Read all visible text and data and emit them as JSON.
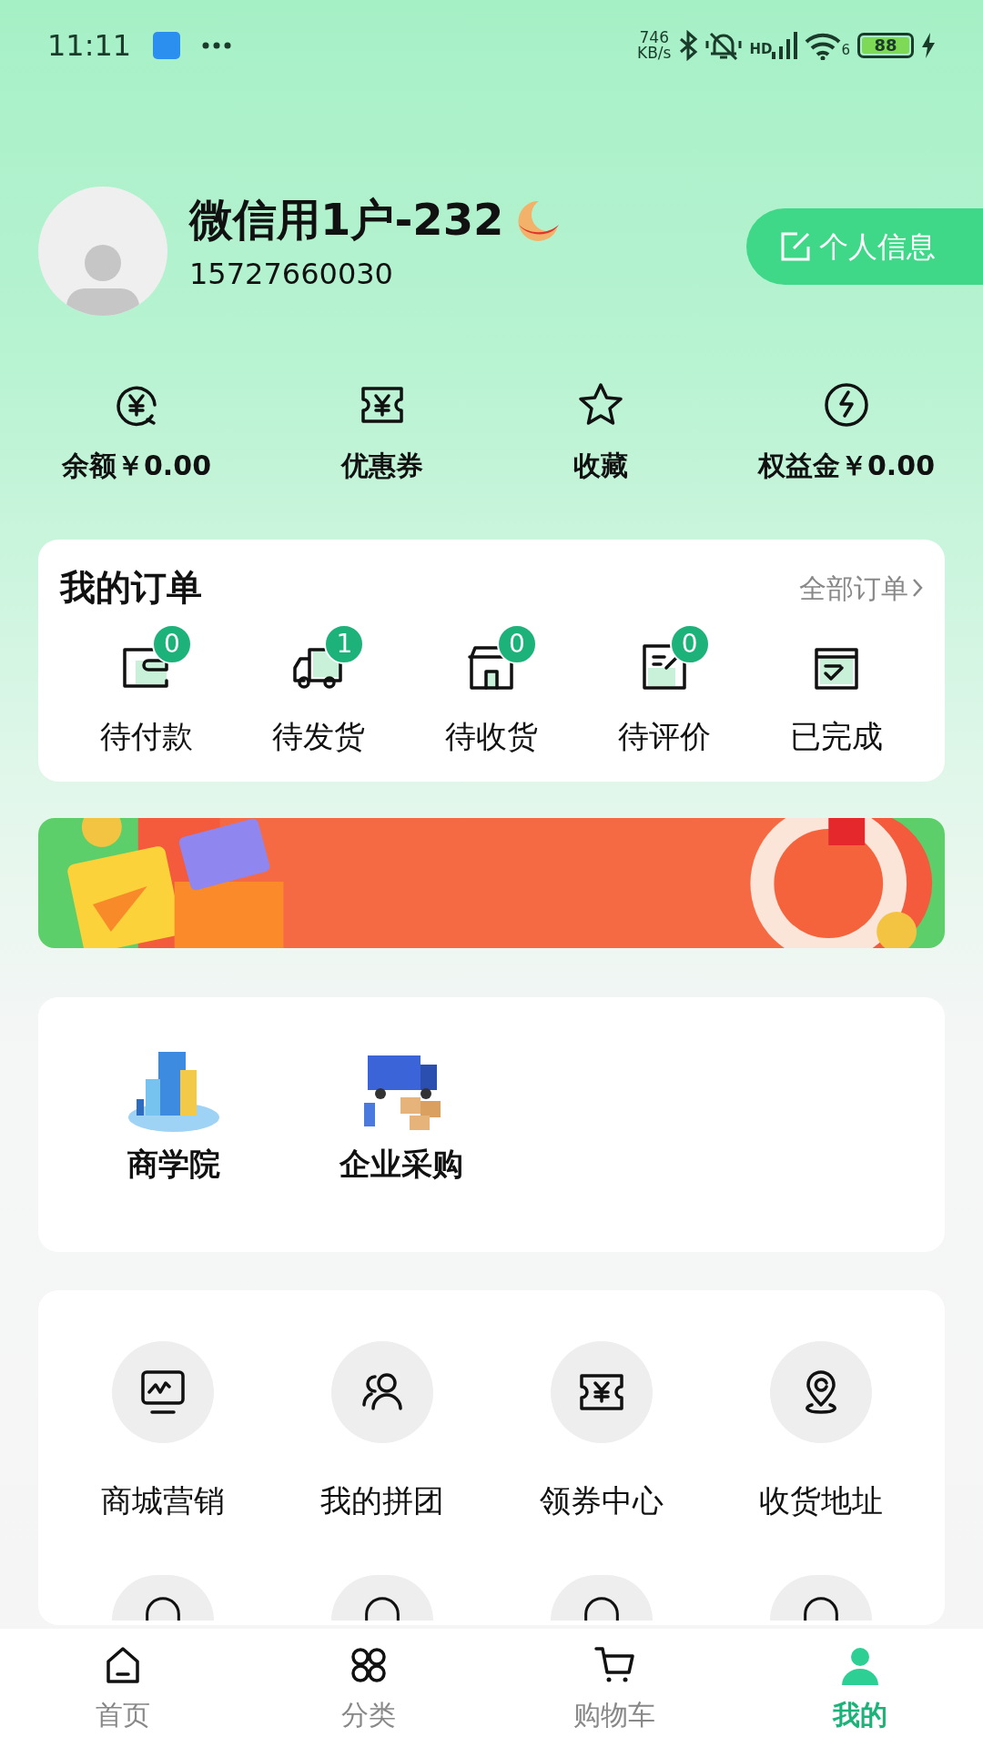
{
  "status_bar": {
    "time": "11:11",
    "net_speed": "746",
    "net_unit": "KB/s",
    "signal_label": "HD",
    "wifi_label": "6",
    "battery": "88"
  },
  "profile": {
    "name": "微信用1户-232",
    "phone": "15727660030",
    "edit_button": "个人信息"
  },
  "stats": [
    {
      "label": "余额￥0.00"
    },
    {
      "label": "优惠券"
    },
    {
      "label": "收藏"
    },
    {
      "label": "权益金￥0.00"
    }
  ],
  "orders": {
    "title": "我的订单",
    "all_link": "全部订单",
    "items": [
      {
        "label": "待付款",
        "badge": "0"
      },
      {
        "label": "待发货",
        "badge": "1"
      },
      {
        "label": "待收货",
        "badge": "0"
      },
      {
        "label": "待评价",
        "badge": "0"
      },
      {
        "label": "已完成"
      }
    ]
  },
  "services": [
    {
      "label": "商学院"
    },
    {
      "label": "企业采购"
    }
  ],
  "tools": [
    {
      "label": "商城营销"
    },
    {
      "label": "我的拼团"
    },
    {
      "label": "领券中心"
    },
    {
      "label": "收货地址"
    }
  ],
  "tabs": [
    {
      "label": "首页",
      "selected": false
    },
    {
      "label": "分类",
      "selected": false
    },
    {
      "label": "购物车",
      "selected": false
    },
    {
      "label": "我的",
      "selected": true
    }
  ]
}
